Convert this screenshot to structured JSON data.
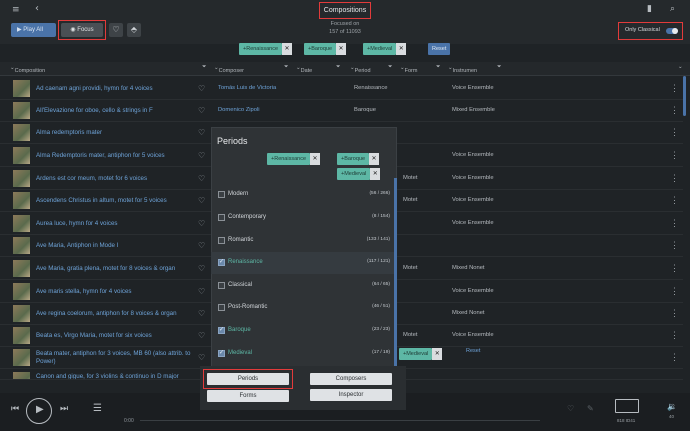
{
  "header": {
    "title": "Compositions",
    "subtitle_line1": "Focused on",
    "subtitle_line2": "157 of 11093",
    "play_all": "Play All",
    "focus": "Focus",
    "only_classical": "Only Classical"
  },
  "filter_chips": [
    {
      "label": "Renaissance"
    },
    {
      "label": "Baroque"
    },
    {
      "label": "Medieval"
    }
  ],
  "reset_label": "Reset",
  "columns": [
    "Composition",
    "Composer",
    "Date",
    "Period",
    "Form",
    "Instrumen"
  ],
  "rows": [
    {
      "title": "Ad caenam agni providi, hymn for 4 voices",
      "composer": "Tomás Luis de Victoria",
      "period": "Renaissance",
      "form": "",
      "instr": "Voice Ensemble"
    },
    {
      "title": "All'Elevazione for oboe, cello & strings in F",
      "composer": "Domenico Zipoli",
      "period": "Baroque",
      "form": "",
      "instr": "Mixed Ensemble"
    },
    {
      "title": "Alma redemptoris mater",
      "composer": "",
      "period": "",
      "form": "",
      "instr": ""
    },
    {
      "title": "Alma Redemptoris mater, antiphon for 5 voices",
      "composer": "",
      "period": "",
      "form": "",
      "instr": "Voice Ensemble"
    },
    {
      "title": "Ardens est cor meum, motet for 6 voices",
      "composer": "",
      "period": "",
      "form": "Motet",
      "instr": "Voice Ensemble"
    },
    {
      "title": "Ascendens Christus in altum, motet for 5 voices",
      "composer": "",
      "period": "",
      "form": "Motet",
      "instr": "Voice Ensemble"
    },
    {
      "title": "Aurea luce, hymn for 4 voices",
      "composer": "",
      "period": "",
      "form": "",
      "instr": "Voice Ensemble"
    },
    {
      "title": "Ave Maria, Antiphon in Mode I",
      "composer": "",
      "period": "",
      "form": "",
      "instr": ""
    },
    {
      "title": "Ave Maria, gratia plena, motet for 8 voices & organ",
      "composer": "",
      "period": "",
      "form": "Motet",
      "instr": "Mixed Nonet"
    },
    {
      "title": "Ave maris stella, hymn for 4 voices",
      "composer": "",
      "period": "",
      "form": "",
      "instr": "Voice Ensemble"
    },
    {
      "title": "Ave regina coelorum, antiphon for 8 voices & organ",
      "composer": "",
      "period": "",
      "form": "",
      "instr": "Mixed Nonet"
    },
    {
      "title": "Beata es, Virgo Maria, motet for six voices",
      "composer": "",
      "period": "",
      "form": "Motet",
      "instr": "Voice Ensemble"
    },
    {
      "title": "Beata mater, antiphon for 3 voices, MB 60 (also attrib. to Power)",
      "composer": "",
      "period": "",
      "form": "",
      "instr": ""
    },
    {
      "title": "Canon and gigue, for 3 violins & continuo in D major",
      "composer": "",
      "period": "",
      "form": "",
      "instr": ""
    }
  ],
  "periods_panel": {
    "title": "Periods",
    "items": [
      {
        "label": "Modern",
        "count": "(56 / 266)",
        "checked": false
      },
      {
        "label": "Contemporary",
        "count": "(8 / 154)",
        "checked": false
      },
      {
        "label": "Romantic",
        "count": "(133 / 141)",
        "checked": false
      },
      {
        "label": "Renaissance",
        "count": "(117 / 121)",
        "checked": true
      },
      {
        "label": "Classical",
        "count": "(64 / 65)",
        "checked": false
      },
      {
        "label": "Post-Romantic",
        "count": "(46 / 51)",
        "checked": false
      },
      {
        "label": "Baroque",
        "count": "(23 / 23)",
        "checked": true
      },
      {
        "label": "Medieval",
        "count": "(17 / 19)",
        "checked": true
      }
    ]
  },
  "bottom_buttons": {
    "periods": "Periods",
    "composers": "Composers",
    "forms": "Forms",
    "inspector": "Inspector"
  },
  "player": {
    "time": "0:00",
    "device": "818 ID41",
    "volume": "40"
  }
}
